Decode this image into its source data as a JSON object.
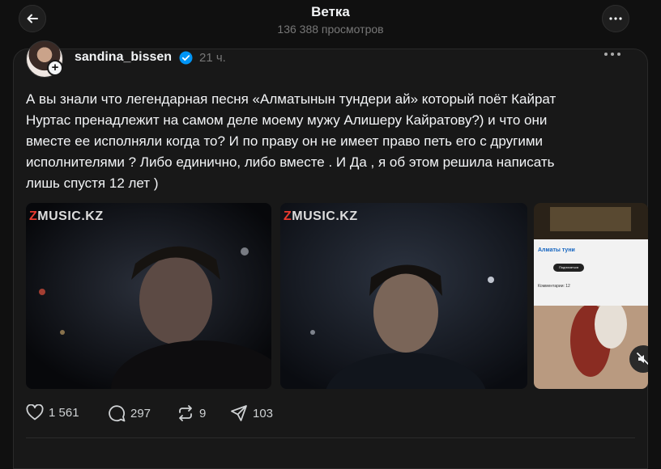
{
  "header": {
    "title": "Ветка",
    "views": "136 388 просмотров"
  },
  "post": {
    "username": "sandina_bissen",
    "time": "21 ч.",
    "lines": [
      "А вы знали что легендарная песня «Алматынын тундери ай» который поёт Кайрат",
      "Нуртас пренадлежит на самом деле моему мужу Алишеру Кайратову?) и что они",
      "вместе ее исполняли когда то? И по праву он не имеет право петь его с другими",
      "исполнителями ? Либо единично, либо вместе . И Да , я об этом решила написать",
      "лишь спустя 12 лет )"
    ],
    "media": [
      {
        "watermark_z": "Z",
        "watermark_rest": "MUSIC.KZ"
      },
      {
        "watermark_z": "Z",
        "watermark_rest": "MUSIC.KZ"
      },
      {
        "yt_title": "Алматы туни",
        "yt_button": "Подписаться",
        "yt_comments": "Комментарии: 12"
      }
    ],
    "stats": {
      "likes": "1 561",
      "comments": "297",
      "reposts": "9",
      "shares": "103"
    }
  },
  "colors": {
    "background": "#101010",
    "card": "#181818",
    "verified": "#0095f6",
    "watermark_accent": "#e83a2f",
    "muted_text": "#777777"
  },
  "icons": [
    "back-arrow-icon",
    "more-icon",
    "verified-icon",
    "heart-icon",
    "comment-icon",
    "repost-icon",
    "share-icon",
    "mute-icon",
    "plus-icon"
  ]
}
